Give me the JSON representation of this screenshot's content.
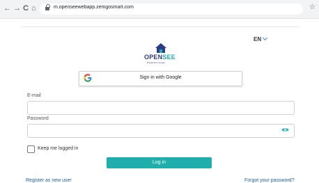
{
  "browser": {
    "back_icon": "←",
    "forward_icon": "→",
    "reload_icon": "C",
    "home_icon": "⌂",
    "url": "m.opensee​webapp.zemgosmart.com",
    "star_icon": "☆"
  },
  "language": {
    "label": "EN"
  },
  "logo": {
    "brand_open": "OPEN",
    "brand_see": "SEE",
    "tagline": "Powered by zemgo"
  },
  "google": {
    "icon": "G",
    "label": "Sign in with Google"
  },
  "form": {
    "email_label": "E-mail",
    "email_value": "",
    "password_label": "Password",
    "password_value": "",
    "keep_logged_in": "Keep me logged in",
    "keep_logged_in_checked": false,
    "login_button": "Log in"
  },
  "links": {
    "register": "Register as new user",
    "forgot": "Forgot your password?"
  },
  "colors": {
    "accent": "#20aead",
    "link": "#1b5fa8",
    "brand_navy": "#2e3b86",
    "brand_teal": "#22aeb8"
  }
}
